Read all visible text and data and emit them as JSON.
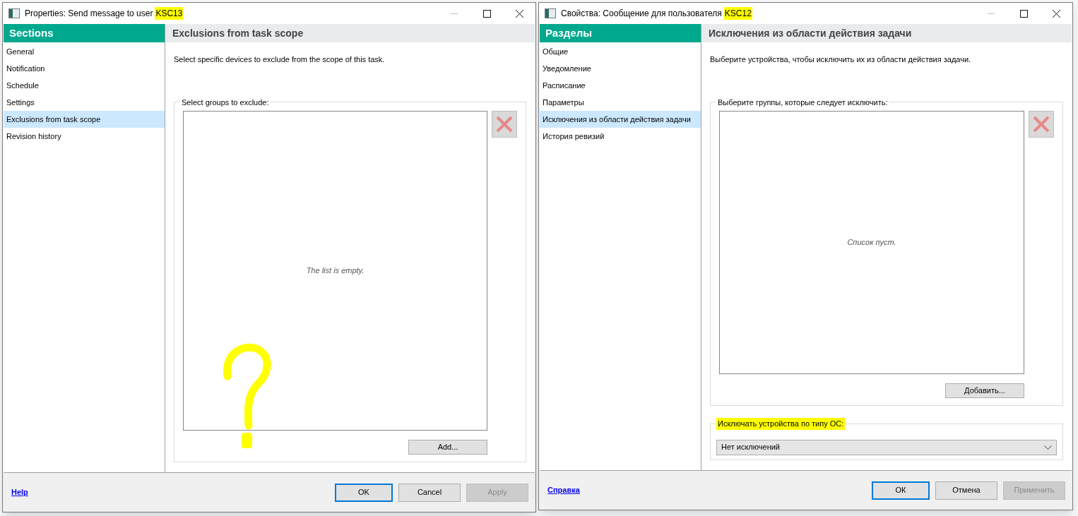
{
  "dialogs": [
    {
      "title": "Properties: Send message to user",
      "title_marked": "KSC13",
      "sections_header": "Sections",
      "sections": [
        {
          "label": "General",
          "selected": false
        },
        {
          "label": "Notification",
          "selected": false
        },
        {
          "label": "Schedule",
          "selected": false
        },
        {
          "label": "Settings",
          "selected": false
        },
        {
          "label": "Exclusions from task scope",
          "selected": true
        },
        {
          "label": "Revision history",
          "selected": false
        }
      ],
      "page_header": "Exclusions from task scope",
      "description": "Select specific devices to exclude from the scope of this task.",
      "groups_label": "Select groups to exclude:",
      "list_empty_text": "The list is empty.",
      "add_button": "Add...",
      "help_link": "Help",
      "buttons": [
        {
          "label": "OK",
          "default": true,
          "disabled": false
        },
        {
          "label": "Cancel",
          "default": false,
          "disabled": false
        },
        {
          "label": "Apply",
          "default": false,
          "disabled": true
        }
      ],
      "question_mark_drawn": true
    },
    {
      "title": "Свойства: Сообщение для пользователя",
      "title_marked": "KSC12",
      "sections_header": "Разделы",
      "sections": [
        {
          "label": "Общие",
          "selected": false
        },
        {
          "label": "Уведомление",
          "selected": false
        },
        {
          "label": "Расписание",
          "selected": false
        },
        {
          "label": "Параметры",
          "selected": false
        },
        {
          "label": "Исключения из области действия задачи",
          "selected": true
        },
        {
          "label": "История ревизий",
          "selected": false
        }
      ],
      "page_header": "Исключения из области действия задачи",
      "description": "Выберите устройства, чтобы исключить их из области действия задачи.",
      "groups_label": "Выберите группы, которые следует исключить:",
      "list_empty_text": "Список пуст.",
      "add_button": "Добавить...",
      "os_exclusion": {
        "label": "Исключать устройства по типу ОС:",
        "highlighted": true,
        "value": "Нет исключений"
      },
      "help_link": "Справка",
      "buttons": [
        {
          "label": "ОК",
          "default": true,
          "disabled": false
        },
        {
          "label": "Отмена",
          "default": false,
          "disabled": false
        },
        {
          "label": "Применить",
          "default": false,
          "disabled": true
        }
      ]
    }
  ]
}
